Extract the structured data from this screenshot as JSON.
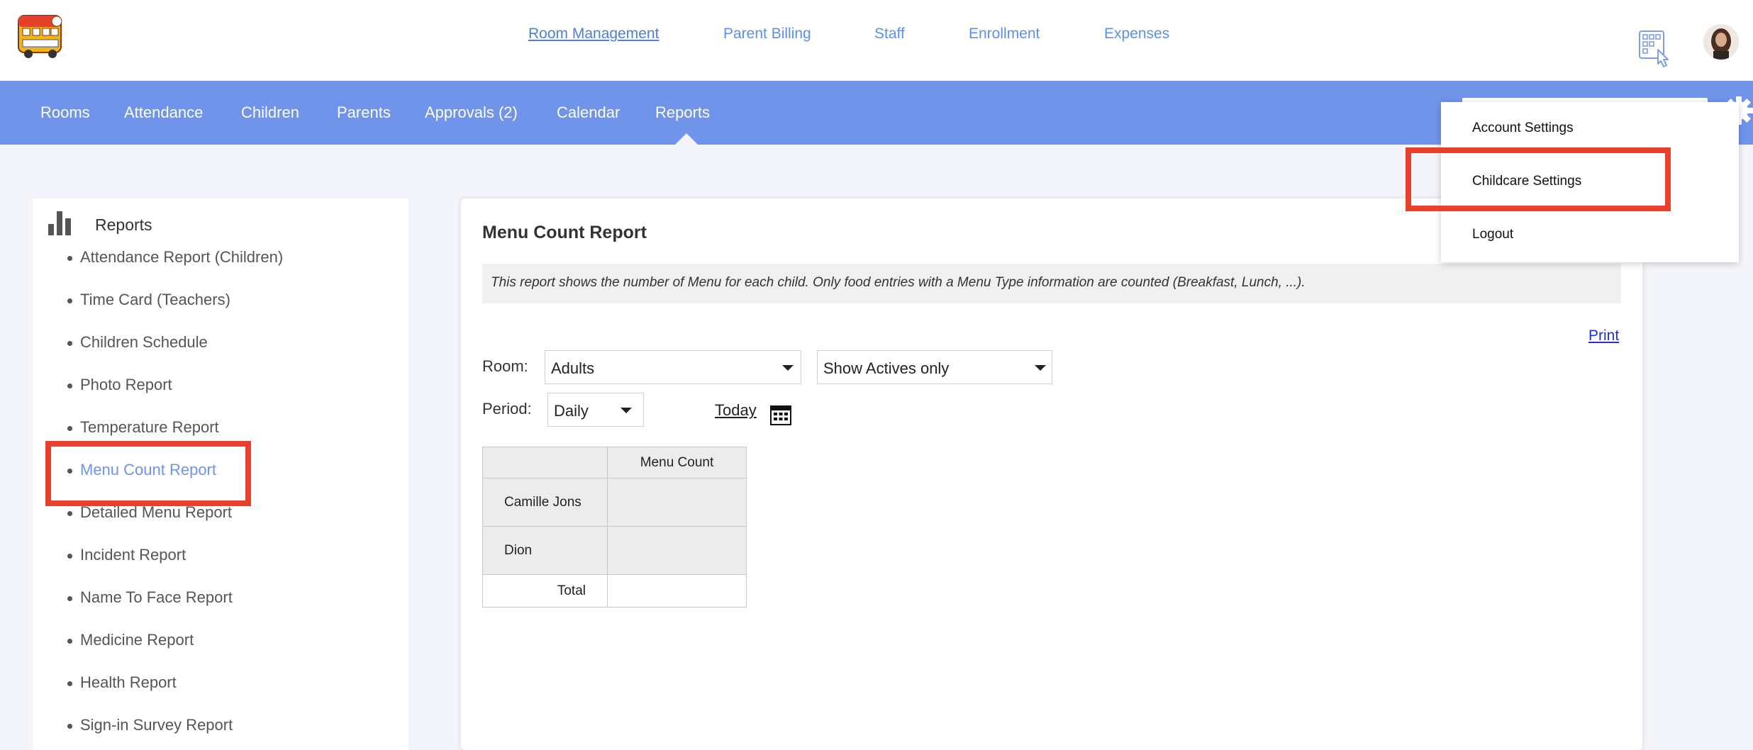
{
  "colors": {
    "accent_blue": "#6f94ea",
    "link_blue": "#5b8ff0",
    "highlight_red": "#e8402a",
    "print_link": "#2133c6"
  },
  "top_nav": {
    "items": [
      {
        "label": "Room Management",
        "active": true
      },
      {
        "label": "Parent Billing"
      },
      {
        "label": "Staff"
      },
      {
        "label": "Enrollment"
      },
      {
        "label": "Expenses"
      }
    ],
    "icons": [
      "logo",
      "qr-scan-icon",
      "avatar"
    ]
  },
  "sub_nav": {
    "items": [
      {
        "label": "Rooms"
      },
      {
        "label": "Attendance"
      },
      {
        "label": "Children"
      },
      {
        "label": "Parents"
      },
      {
        "label": "Approvals (2)"
      },
      {
        "label": "Calendar"
      },
      {
        "label": "Reports",
        "active": true
      }
    ]
  },
  "sidebar": {
    "title": "Reports",
    "icon": "bar-chart-icon",
    "items": [
      {
        "label": "Attendance Report (Children)"
      },
      {
        "label": "Time Card (Teachers)"
      },
      {
        "label": "Children Schedule"
      },
      {
        "label": "Photo Report"
      },
      {
        "label": "Temperature Report"
      },
      {
        "label": "Menu Count Report",
        "active": true
      },
      {
        "label": "Detailed Menu Report"
      },
      {
        "label": "Incident Report"
      },
      {
        "label": "Name To Face Report"
      },
      {
        "label": "Medicine Report"
      },
      {
        "label": "Health Report"
      },
      {
        "label": "Sign-in Survey Report"
      }
    ]
  },
  "main": {
    "title": "Menu Count Report",
    "description": "This report shows the number of Menu for each child. Only food entries with a Menu Type information are counted (Breakfast, Lunch, ...).",
    "print_label": "Print",
    "room_label": "Room:",
    "room_value": "Adults",
    "status_value": "Show Actives only",
    "period_label": "Period:",
    "period_value": "Daily",
    "today_label": "Today",
    "table": {
      "column_header": "Menu Count",
      "rows": [
        {
          "name": "Camille Jons",
          "value": ""
        },
        {
          "name": "Dion",
          "value": ""
        }
      ],
      "total_label": "Total",
      "total_value": ""
    }
  },
  "dropdown": {
    "items": [
      {
        "label": "Account Settings"
      },
      {
        "label": "Childcare Settings",
        "highlighted": true
      },
      {
        "label": "Logout"
      }
    ]
  }
}
